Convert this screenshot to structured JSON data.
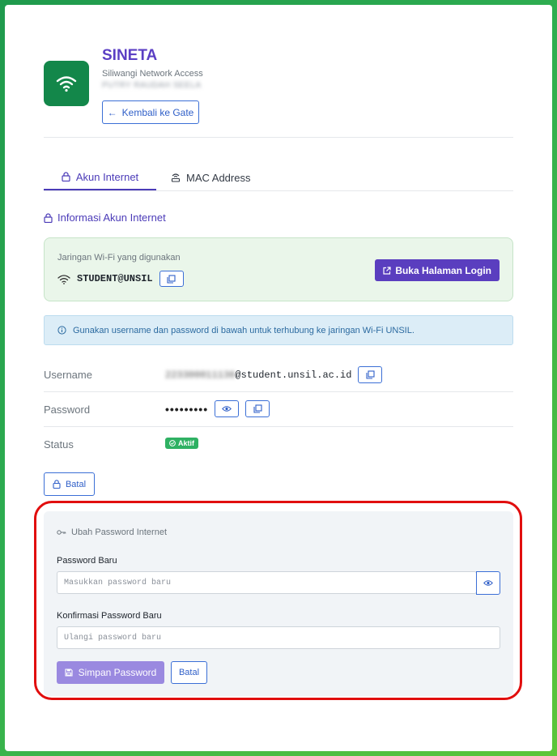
{
  "header": {
    "title": "SINETA",
    "subtitle": "Siliwangi Network Access",
    "user_name": "PUTRY RAUDAH SEELA",
    "back_label": "Kembali ke Gate"
  },
  "tabs": [
    {
      "label": "Akun Internet",
      "active": true
    },
    {
      "label": "MAC Address",
      "active": false
    }
  ],
  "section_title": "Informasi Akun Internet",
  "wifi": {
    "label": "Jaringan Wi-Fi yang digunakan",
    "ssid": "STUDENT@UNSIL",
    "login_button": "Buka Halaman Login"
  },
  "alert_text": "Gunakan username dan password di bawah untuk terhubung ke jaringan Wi-Fi UNSIL.",
  "account": {
    "username_label": "Username",
    "username_prefix": "223300011136",
    "username_domain": "@student.unsil.ac.id",
    "password_label": "Password",
    "password_masked": "•••••••••",
    "status_label": "Status",
    "status_value": "Aktif"
  },
  "cancel_top": "Batal",
  "change_password": {
    "title": "Ubah Password Internet",
    "new_label": "Password Baru",
    "new_placeholder": "Masukkan password baru",
    "confirm_label": "Konfirmasi Password Baru",
    "confirm_placeholder": "Ulangi password baru",
    "save_label": "Simpan Password",
    "cancel_label": "Batal"
  },
  "colors": {
    "brand": "#5b3fc4",
    "logo_bg": "#13874a",
    "accent_blue": "#3b6fd6",
    "success": "#2fb163",
    "highlight": "#e10e0e"
  }
}
